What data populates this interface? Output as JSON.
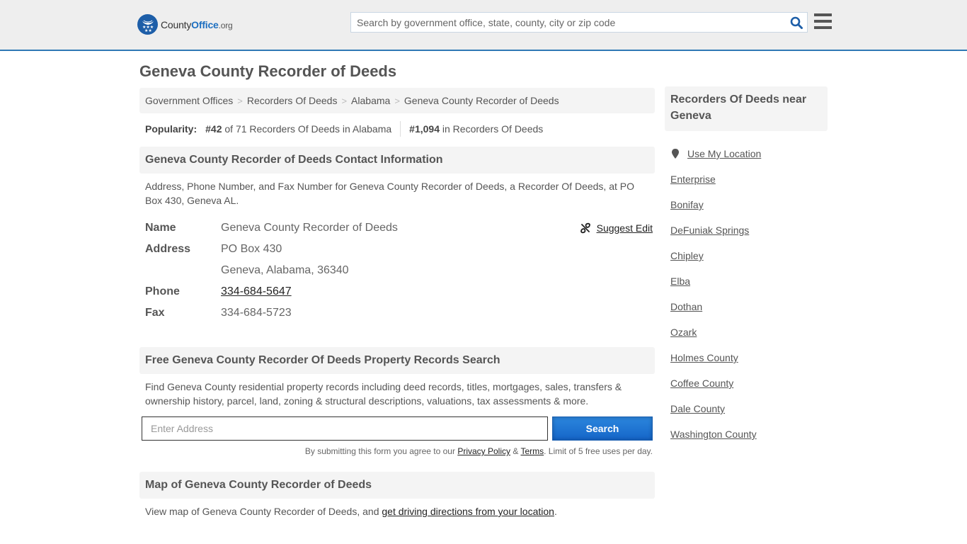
{
  "header": {
    "logo": {
      "county": "County",
      "office": "Office",
      "org": ".org"
    },
    "search_placeholder": "Search by government office, state, county, city or zip code",
    "brand_color": "#1d6fc0",
    "accent_border_color": "#2f79b5"
  },
  "page_title": "Geneva County Recorder of Deeds",
  "breadcrumb": [
    {
      "label": "Government Offices"
    },
    {
      "label": "Recorders Of Deeds"
    },
    {
      "label": "Alabama"
    },
    {
      "label": "Geneva County Recorder of Deeds"
    }
  ],
  "popularity": {
    "label": "Popularity:",
    "state_rank": "#42",
    "state_rank_text": " of 71 Recorders Of Deeds in Alabama",
    "national_rank": "#1,094",
    "national_rank_text": " in Recorders Of Deeds"
  },
  "contact_section": {
    "heading": "Geneva County Recorder of Deeds Contact Information",
    "description": "Address, Phone Number, and Fax Number for Geneva County Recorder of Deeds, a Recorder Of Deeds, at PO Box 430, Geneva AL.",
    "suggest_edit": "Suggest Edit",
    "rows": {
      "name_label": "Name",
      "name_value": "Geneva County Recorder of Deeds",
      "address_label": "Address",
      "address_line1": "PO Box 430",
      "address_line2": "Geneva, Alabama, 36340",
      "phone_label": "Phone",
      "phone_value": "334-684-5647",
      "fax_label": "Fax",
      "fax_value": "334-684-5723"
    }
  },
  "property_section": {
    "heading": "Free Geneva County Recorder Of Deeds Property Records Search",
    "description": "Find Geneva County residential property records including deed records, titles, mortgages, sales, transfers & ownership history, parcel, land, zoning & structural descriptions, valuations, tax assessments & more.",
    "address_placeholder": "Enter Address",
    "search_button": "Search",
    "disclaimer_prefix": "By submitting this form you agree to our ",
    "privacy_link": "Privacy Policy",
    "amp": " & ",
    "terms_link": "Terms",
    "disclaimer_suffix": ". Limit of 5 free uses per day."
  },
  "map_section": {
    "heading": "Map of Geneva County Recorder of Deeds",
    "text_prefix": "View map of Geneva County Recorder of Deeds, and ",
    "directions_link": "get driving directions from your location",
    "text_suffix": "."
  },
  "sidebar": {
    "heading": "Recorders Of Deeds near Geneva",
    "use_location": "Use My Location",
    "items": [
      {
        "label": "Enterprise"
      },
      {
        "label": "Bonifay"
      },
      {
        "label": "DeFuniak Springs"
      },
      {
        "label": "Chipley"
      },
      {
        "label": "Elba"
      },
      {
        "label": "Dothan"
      },
      {
        "label": "Ozark"
      },
      {
        "label": "Holmes County"
      },
      {
        "label": "Coffee County"
      },
      {
        "label": "Dale County"
      },
      {
        "label": "Washington County"
      }
    ]
  }
}
